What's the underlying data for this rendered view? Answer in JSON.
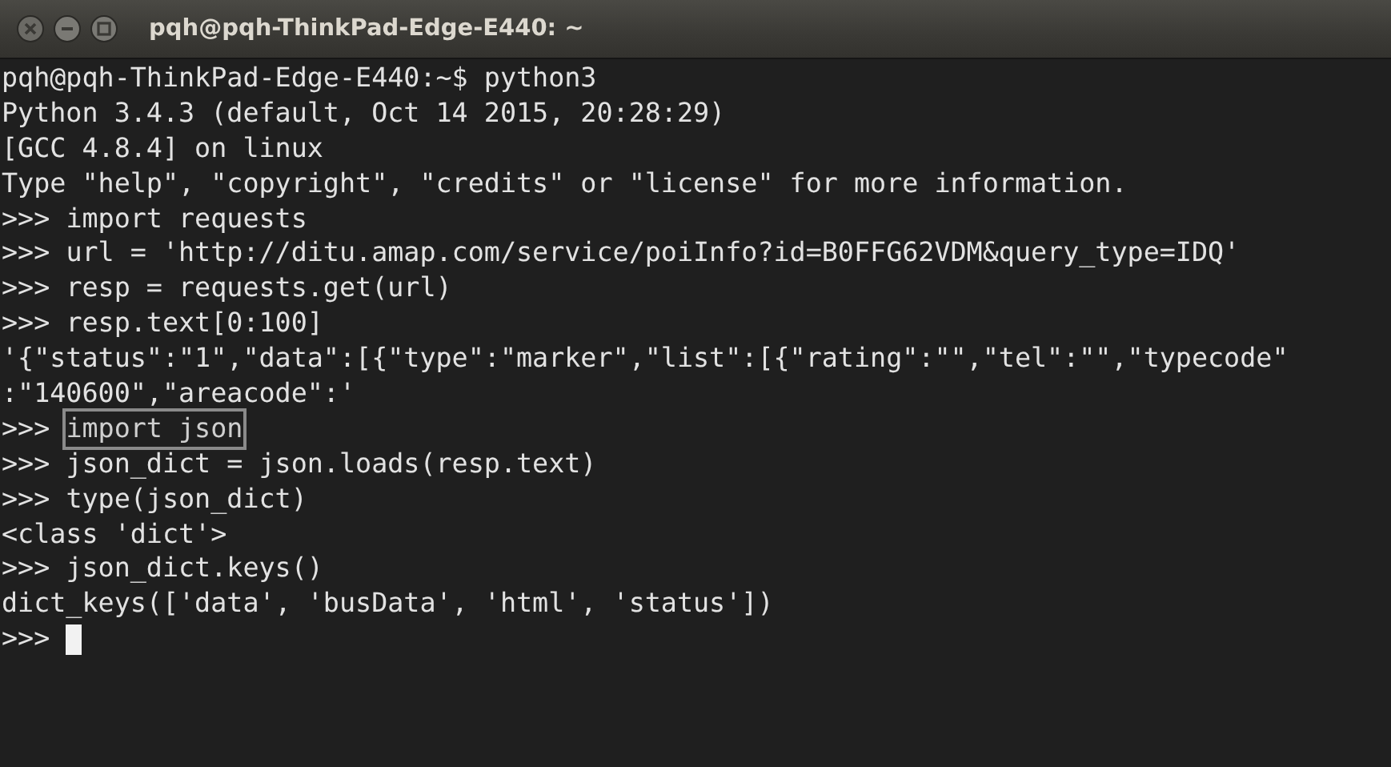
{
  "window": {
    "title": "pqh@pqh-ThinkPad-Edge-E440: ~"
  },
  "terminal": {
    "lines": [
      {
        "text": "pqh@pqh-ThinkPad-Edge-E440:~$ python3",
        "boxed": false,
        "cursor": false
      },
      {
        "text": "Python 3.4.3 (default, Oct 14 2015, 20:28:29)",
        "boxed": false,
        "cursor": false
      },
      {
        "text": "[GCC 4.8.4] on linux",
        "boxed": false,
        "cursor": false
      },
      {
        "text": "Type \"help\", \"copyright\", \"credits\" or \"license\" for more information.",
        "boxed": false,
        "cursor": false
      },
      {
        "prompt": ">>>",
        "text": "import requests",
        "boxed": false,
        "cursor": false
      },
      {
        "prompt": ">>>",
        "text": "url = 'http://ditu.amap.com/service/poiInfo?id=B0FFG62VDM&query_type=IDQ'",
        "boxed": false,
        "cursor": false
      },
      {
        "prompt": ">>>",
        "text": "resp = requests.get(url)",
        "boxed": false,
        "cursor": false
      },
      {
        "prompt": ">>>",
        "text": "resp.text[0:100]",
        "boxed": false,
        "cursor": false
      },
      {
        "text": "'{\"status\":\"1\",\"data\":[{\"type\":\"marker\",\"list\":[{\"rating\":\"\",\"tel\":\"\",\"typecode\"",
        "boxed": false,
        "cursor": false
      },
      {
        "text": ":\"140600\",\"areacode\":'",
        "boxed": false,
        "cursor": false
      },
      {
        "prompt": ">>>",
        "text": "import json",
        "boxed": true,
        "cursor": false
      },
      {
        "prompt": ">>>",
        "text": "json_dict = json.loads(resp.text)",
        "boxed": false,
        "cursor": false
      },
      {
        "prompt": ">>>",
        "text": "type(json_dict)",
        "boxed": false,
        "cursor": false
      },
      {
        "text": "<class 'dict'>",
        "boxed": false,
        "cursor": false
      },
      {
        "prompt": ">>>",
        "text": "json_dict.keys()",
        "boxed": false,
        "cursor": false
      },
      {
        "text": "dict_keys(['data', 'busData', 'html', 'status'])",
        "boxed": false,
        "cursor": false
      },
      {
        "prompt": ">>>",
        "boxed": false,
        "cursor": true
      }
    ]
  }
}
